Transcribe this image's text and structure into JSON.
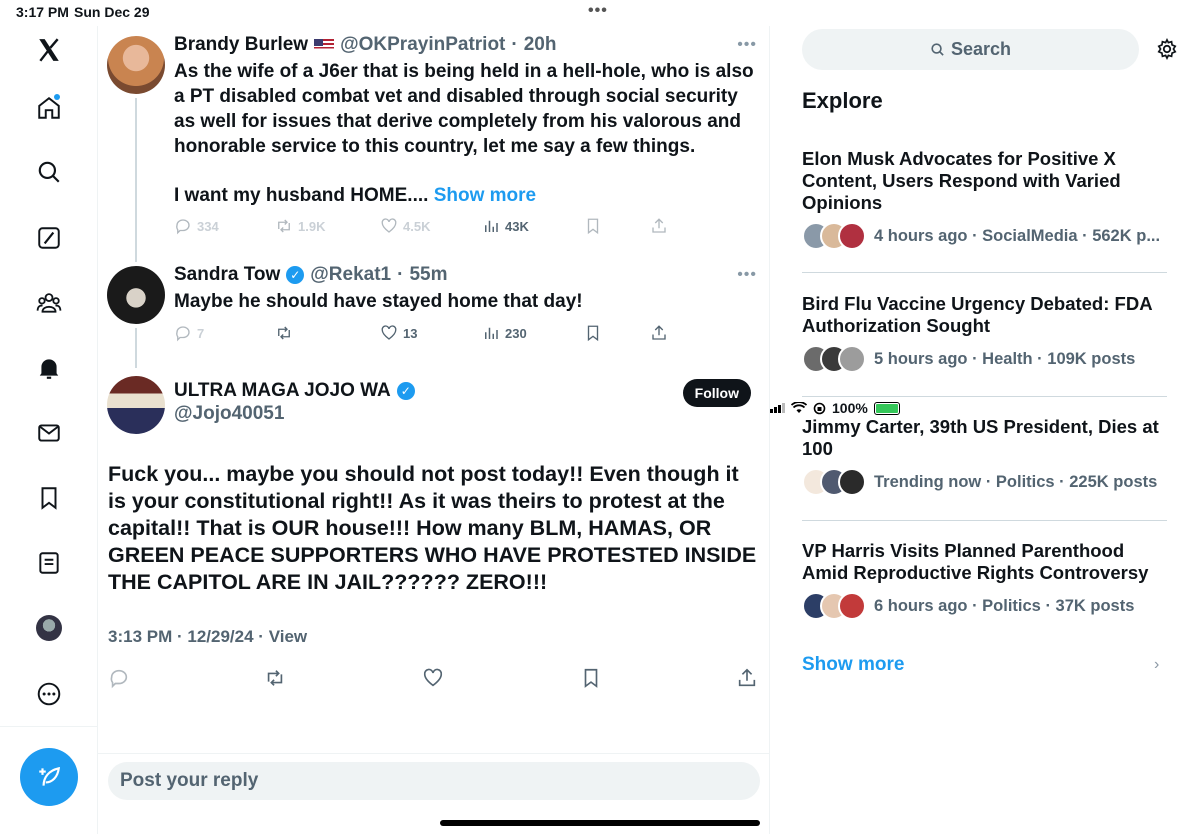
{
  "status": {
    "time": "3:17 PM",
    "date": "Sun Dec 29",
    "battery": "100%"
  },
  "nav": {
    "logo": "X",
    "icons": [
      "home-icon",
      "search-icon",
      "grok-icon",
      "communities-icon",
      "notifications-icon",
      "messages-icon",
      "bookmarks-icon",
      "lists-icon",
      "profile-avatar",
      "more-icon"
    ],
    "compose": "compose-icon"
  },
  "thread": {
    "tweet1": {
      "name": "Brandy Burlew",
      "handle": "@OKPrayinPatriot",
      "time": "20h",
      "text": "As the wife of a J6er that is being held in a hell-hole, who is also a PT disabled combat vet and disabled through social security as well for issues that derive completely from his valorous and honorable service to this country, let me say a few things.",
      "text2": "I want my husband HOME....",
      "show_more": "Show more",
      "replies": "334",
      "reposts": "1.9K",
      "likes": "4.5K",
      "views": "43K"
    },
    "tweet2": {
      "name": "Sandra Tow",
      "handle": "@Rekat1",
      "time": "55m",
      "text": "Maybe he should have stayed home that day!",
      "replies": "7",
      "likes": "13",
      "views": "230"
    },
    "main": {
      "name": "ULTRA MAGA JOJO WA",
      "handle": "@Jojo40051",
      "follow": "Follow",
      "text": "Fuck you...  maybe you should not post today!!  Even though it is your constitutional right!!  As it was theirs to protest at the capital!!  That is OUR house!!!  How many BLM, HAMAS, OR GREEN PEACE SUPPORTERS WHO HAVE PROTESTED INSIDE THE CAPITOL ARE IN JAIL??????  ZERO!!!",
      "meta_time": "3:13 PM",
      "meta_date": "12/29/24",
      "meta_view": "View"
    },
    "reply_placeholder": "Post your reply"
  },
  "right": {
    "search_label": "Search",
    "explore_title": "Explore",
    "trends": [
      {
        "title": "Elon Musk Advocates for Positive X Content, Users Respond with Varied Opinions",
        "meta": "4 hours ago · SocialMedia · 562K p..."
      },
      {
        "title": "Bird Flu Vaccine Urgency Debated: FDA Authorization Sought",
        "meta": "5 hours ago · Health · 109K posts"
      },
      {
        "title": "Jimmy Carter, 39th US President, Dies at 100",
        "meta": "Trending now · Politics · 225K posts"
      },
      {
        "title": "VP Harris Visits Planned Parenthood Amid Reproductive Rights Controversy",
        "meta": "6 hours ago · Politics · 37K posts"
      }
    ],
    "show_more": "Show more"
  },
  "colors": {
    "accent": "#1d9bf0",
    "text": "#0f1419",
    "muted": "#536471"
  }
}
